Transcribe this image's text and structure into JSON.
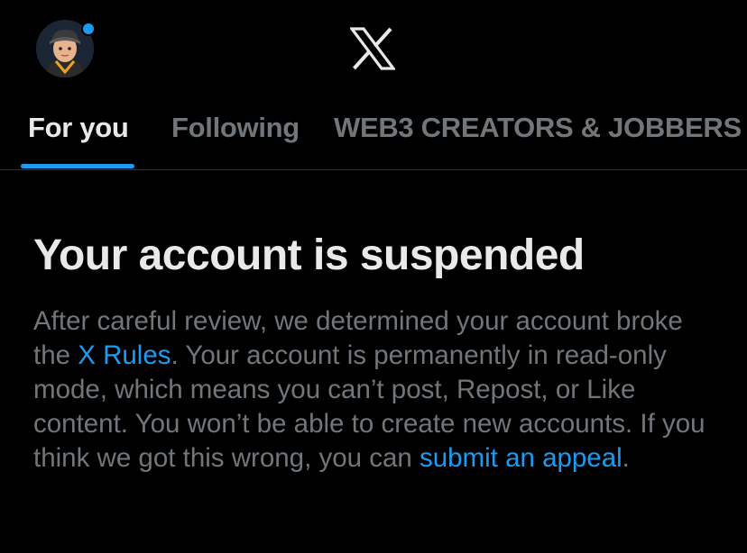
{
  "header": {
    "avatar_icon": "user-avatar",
    "logo_icon": "x-logo-icon",
    "notification_dot_color": "#1d9bf0"
  },
  "tabs": [
    {
      "label": "For you",
      "active": true
    },
    {
      "label": "Following",
      "active": false
    },
    {
      "label": "WEB3 CREATORS & JOBBERS",
      "active": false
    }
  ],
  "suspension": {
    "title": "Your account is suspended",
    "body_part1": "After careful review, we determined your account broke the ",
    "rules_link": "X Rules",
    "body_part2": ". Your account is permanently in read-only mode, which means you can’t post, Repost, or Like content. You won’t be able to create new accounts. If you think we got this wrong, you can ",
    "appeal_link": "submit an appeal",
    "body_part3": "."
  },
  "colors": {
    "accent": "#1d9bf0",
    "background": "#000000",
    "primary_text": "#e7e9ea",
    "secondary_text": "#71767b"
  }
}
